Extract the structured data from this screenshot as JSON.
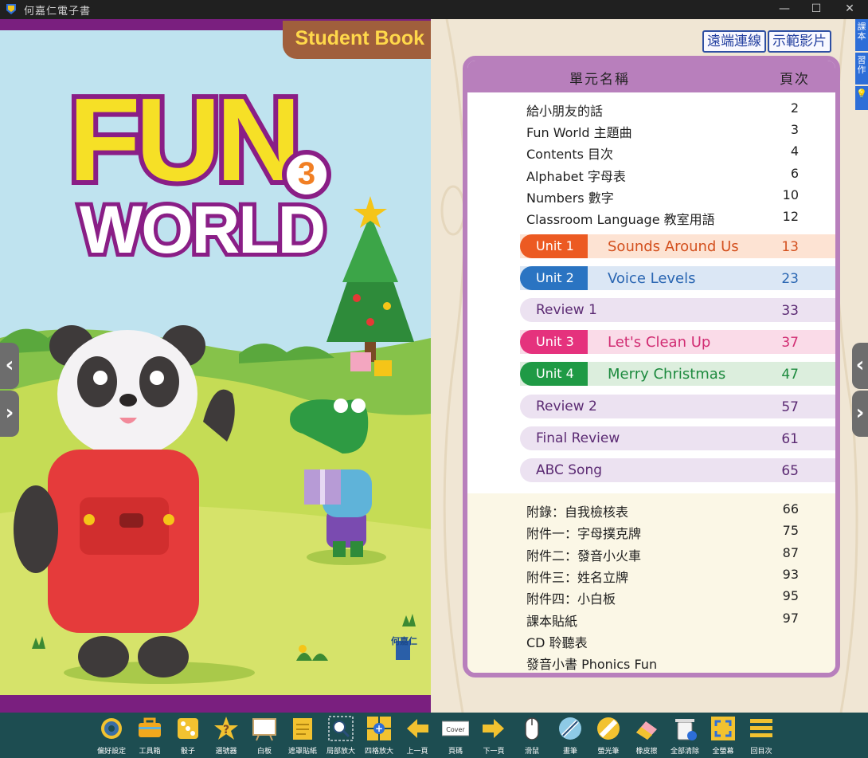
{
  "window": {
    "title": "何嘉仁電子書",
    "minimize": "—",
    "maximize": "☐",
    "close": "✕"
  },
  "cover": {
    "badge": "Student Book",
    "logo_top": "FUN",
    "logo_bottom": "WORLD",
    "level": "3",
    "publisher": "何嘉仁"
  },
  "nav": {
    "prev": "‹",
    "next": "›"
  },
  "page_links": {
    "remote": "遠端連線",
    "video": "示範影片"
  },
  "side_tabs": {
    "textbook": "課本",
    "worksheet": "習作",
    "tips": "💡"
  },
  "toc": {
    "header_name": "單元名稱",
    "header_page": "頁次",
    "intro_rows": [
      {
        "label": "給小朋友的話",
        "page": "2"
      },
      {
        "label": "Fun World 主題曲",
        "page": "3"
      },
      {
        "label": "Contents 目次",
        "page": "4"
      },
      {
        "label": "Alphabet 字母表",
        "page": "6"
      },
      {
        "label": "Numbers 數字",
        "page": "10"
      },
      {
        "label": "Classroom Language 教室用語",
        "page": "12"
      }
    ],
    "units": [
      {
        "unit": "Unit 1",
        "title": "Sounds Around Us",
        "page": "13",
        "color": "#ec5a22",
        "bg": "#fde3d3",
        "text": "#d3501e"
      },
      {
        "unit": "Unit 2",
        "title": "Voice Levels",
        "page": "23",
        "color": "#2a74c2",
        "bg": "#dbe7f5",
        "text": "#2a66b2"
      },
      {
        "unit": "Review 1",
        "title": "",
        "page": "33"
      },
      {
        "unit": "Unit 3",
        "title": "Let's Clean Up",
        "page": "37",
        "color": "#e5327d",
        "bg": "#fadbe8",
        "text": "#d12c72"
      },
      {
        "unit": "Unit 4",
        "title": "Merry Christmas",
        "page": "47",
        "color": "#1f9a45",
        "bg": "#dceedd",
        "text": "#1d8a3e"
      },
      {
        "unit": "Review 2",
        "title": "",
        "page": "57"
      },
      {
        "unit": "Final Review",
        "title": "",
        "page": "61"
      },
      {
        "unit": "ABC Song",
        "title": "",
        "page": "65"
      }
    ],
    "appendix_rows": [
      {
        "label": "附錄：自我檢核表",
        "page": "66"
      },
      {
        "label": "附件一：字母撲克牌",
        "page": "75"
      },
      {
        "label": "附件二：發音小火車",
        "page": "87"
      },
      {
        "label": "附件三：姓名立牌",
        "page": "93"
      },
      {
        "label": "附件四：小白板",
        "page": "95"
      },
      {
        "label": "課本貼紙",
        "page": "97"
      },
      {
        "label": "CD 聆聽表",
        "page": ""
      },
      {
        "label": "發音小書 Phonics Fun",
        "page": ""
      }
    ]
  },
  "toolbar": [
    {
      "label": "偏好設定",
      "icon": "gear-icon"
    },
    {
      "label": "工具箱",
      "icon": "toolbox-icon"
    },
    {
      "label": "骰子",
      "icon": "dice-icon"
    },
    {
      "label": "選號器",
      "icon": "question-star-icon"
    },
    {
      "label": "白板",
      "icon": "whiteboard-icon"
    },
    {
      "label": "遮罩貼紙",
      "icon": "sticky-note-icon"
    },
    {
      "label": "局部放大",
      "icon": "magnifier-icon"
    },
    {
      "label": "四格放大",
      "icon": "four-grid-zoom-icon"
    },
    {
      "label": "上一頁",
      "icon": "arrow-left-icon"
    },
    {
      "label": "頁碼",
      "icon": "page-number-icon",
      "box_text": "Cover"
    },
    {
      "label": "下一頁",
      "icon": "arrow-right-icon"
    },
    {
      "label": "滑鼠",
      "icon": "mouse-icon"
    },
    {
      "label": "畫筆",
      "icon": "pen-icon"
    },
    {
      "label": "螢光筆",
      "icon": "highlighter-icon"
    },
    {
      "label": "橡皮擦",
      "icon": "eraser-icon"
    },
    {
      "label": "全部清除",
      "icon": "trash-icon"
    },
    {
      "label": "全螢幕",
      "icon": "fullscreen-icon"
    },
    {
      "label": "回目次",
      "icon": "contents-list-icon"
    }
  ]
}
